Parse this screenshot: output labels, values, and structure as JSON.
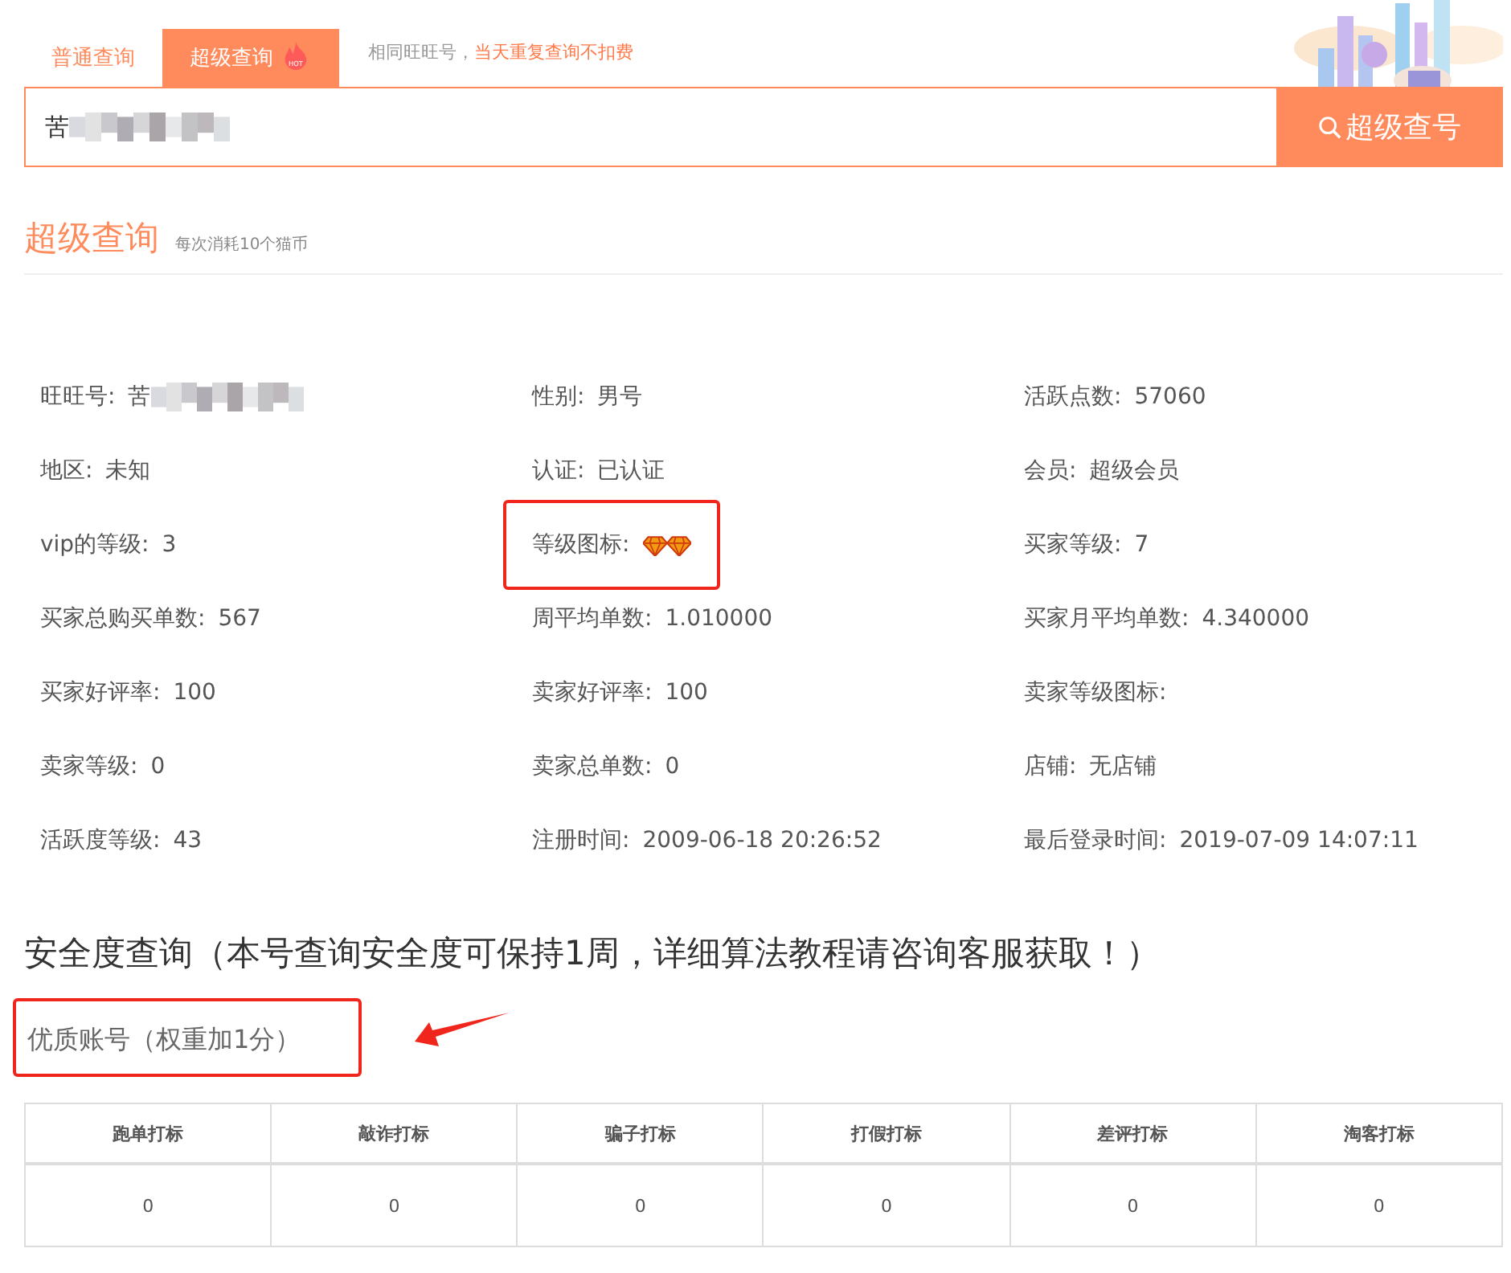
{
  "tabs": [
    {
      "label": "普通查询",
      "selected": false
    },
    {
      "label": "超级查询",
      "selected": true,
      "badge": "HOT"
    }
  ],
  "tab_note": {
    "text": "相同旺旺号，",
    "highlight": "当天重复查询不扣费"
  },
  "search": {
    "value": "苦",
    "blurred": true,
    "button": "超级查号"
  },
  "section": {
    "title": "超级查询",
    "subtitle": "每次消耗10个猫币"
  },
  "info": [
    {
      "label": "旺旺号:",
      "value": "苦",
      "blurred": true,
      "highlighted": false
    },
    {
      "label": "性别:",
      "value": "男号",
      "highlighted": false
    },
    {
      "label": "活跃点数:",
      "value": "57060",
      "highlighted": false
    },
    {
      "label": "地区:",
      "value": "未知",
      "highlighted": false
    },
    {
      "label": "认证:",
      "value": "已认证",
      "highlighted": false
    },
    {
      "label": "会员:",
      "value": "超级会员",
      "highlighted": false
    },
    {
      "label": "vip的等级:",
      "value": "3",
      "highlighted": false
    },
    {
      "label": "等级图标:",
      "kind": "diamonds",
      "highlighted": true
    },
    {
      "label": "买家等级:",
      "value": "7",
      "highlighted": false
    },
    {
      "label": "买家总购买单数:",
      "value": "567",
      "highlighted": false
    },
    {
      "label": "周平均单数:",
      "value": "1.010000",
      "highlighted": false
    },
    {
      "label": "买家月平均单数:",
      "value": "4.340000",
      "highlighted": false
    },
    {
      "label": "买家好评率:",
      "value": "100",
      "highlighted": false
    },
    {
      "label": "卖家好评率:",
      "value": "100",
      "highlighted": false
    },
    {
      "label": "卖家等级图标:",
      "highlighted": false
    },
    {
      "label": "卖家等级:",
      "value": "0",
      "highlighted": false
    },
    {
      "label": "卖家总单数:",
      "value": "0",
      "highlighted": false
    },
    {
      "label": "店铺:",
      "value": "无店铺",
      "highlighted": false
    },
    {
      "label": "活跃度等级:",
      "value": "43",
      "highlighted": false
    },
    {
      "label": "注册时间:",
      "value": "2009-06-18 20:26:52",
      "highlighted": false
    },
    {
      "label": "最后登录时间:",
      "value": "2019-07-09 14:07:11",
      "highlighted": false
    }
  ],
  "safety": {
    "title": "安全度查询（本号查询安全度可保持1周，详细算法教程请咨询客服获取！）",
    "result": "优质账号（权重加1分）",
    "highlighted": true
  },
  "table": {
    "columns": [
      "跑单打标",
      "敲诈打标",
      "骗子打标",
      "打假打标",
      "差评打标",
      "淘客打标"
    ],
    "rows": [
      [
        "0",
        "0",
        "0",
        "0",
        "0",
        "0"
      ]
    ]
  }
}
